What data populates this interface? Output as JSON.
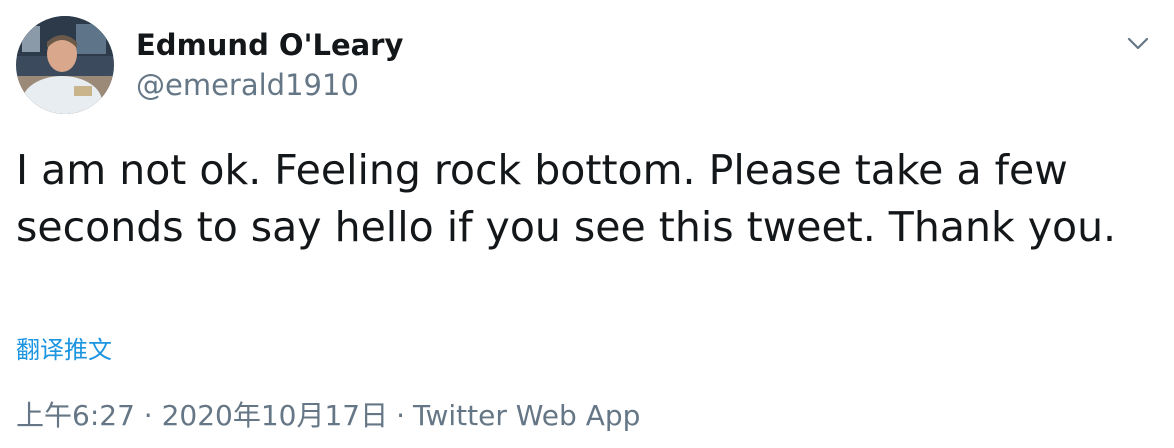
{
  "tweet": {
    "author": {
      "display_name": "Edmund O'Leary",
      "handle": "@emerald1910",
      "avatar_icon": "profile-photo"
    },
    "menu_icon": "chevron-down-icon",
    "text": "I am not ok. Feeling rock bottom. Please take a few seconds to say hello if you see this tweet. Thank you.",
    "translate_label": "翻译推文",
    "timestamp": "上午6:27 · 2020年10月17日",
    "separator": "·",
    "source": "Twitter Web App"
  },
  "colors": {
    "text": "#14171a",
    "secondary": "#657786",
    "link": "#1b95e0",
    "background": "#ffffff"
  }
}
